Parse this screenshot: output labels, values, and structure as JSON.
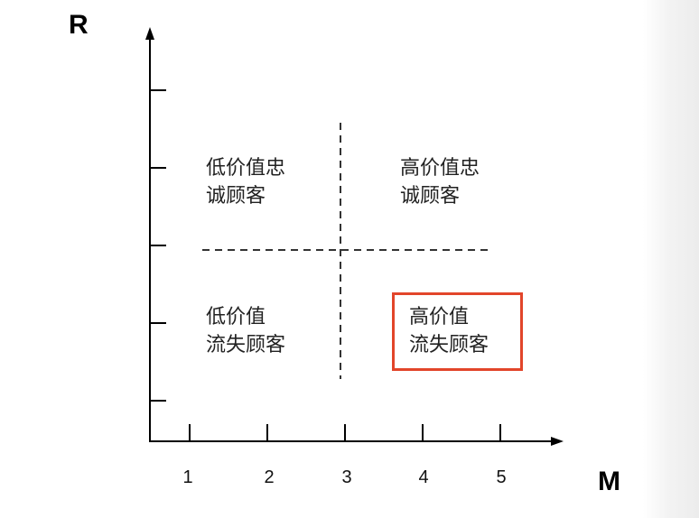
{
  "axes": {
    "y_title": "R",
    "x_title": "M",
    "x_tick_labels": [
      "1",
      "2",
      "3",
      "4",
      "5"
    ]
  },
  "quadrants": {
    "top_left": {
      "line1": "低价值忠",
      "line2": "诚顾客"
    },
    "top_right": {
      "line1": "高价值忠",
      "line2": "诚顾客"
    },
    "bottom_left": {
      "line1": "低价值",
      "line2": "流失顾客"
    },
    "bottom_right": {
      "line1": "高价值",
      "line2": "流失顾客",
      "highlighted": true
    }
  },
  "colors": {
    "axis": "#000000",
    "divider": "#333333",
    "highlight": "#e2452a"
  }
}
